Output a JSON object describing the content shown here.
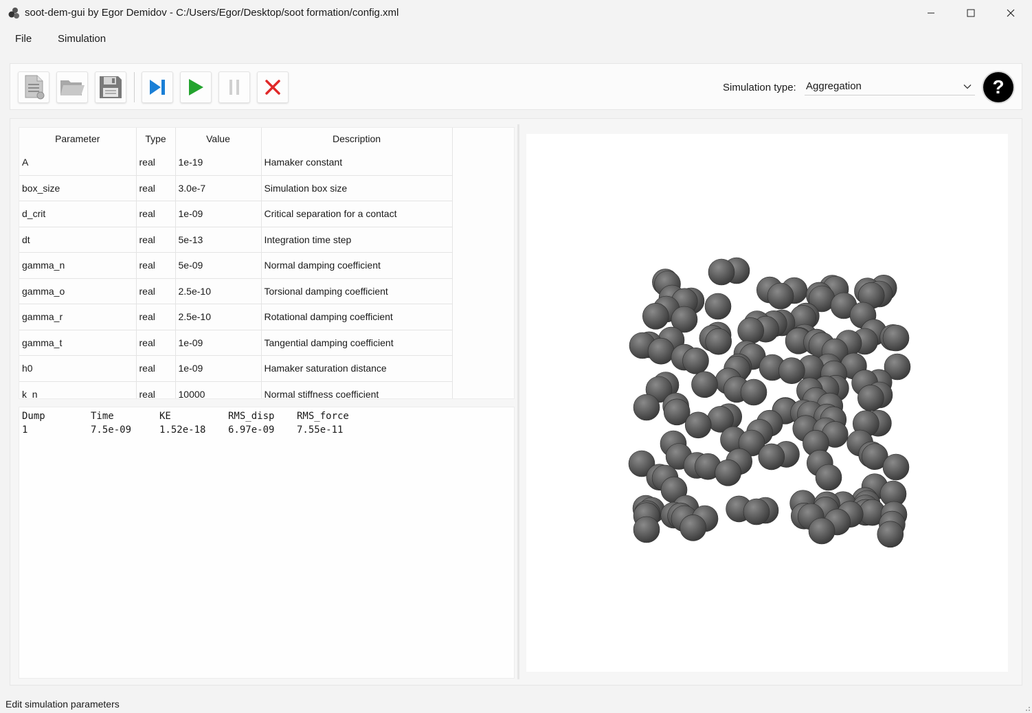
{
  "window": {
    "title": "soot-dem-gui by Egor Demidov - C:/Users/Egor/Desktop/soot formation/config.xml",
    "controls": [
      "minimize-icon",
      "maximize-icon",
      "close-icon"
    ]
  },
  "menu": {
    "file": "File",
    "simulation": "Simulation"
  },
  "toolbar": {
    "buttons": [
      "new-file-icon",
      "open-folder-icon",
      "save-icon",
      "step-icon",
      "play-icon",
      "pause-icon",
      "stop-icon"
    ],
    "sim_type_label": "Simulation type:",
    "sim_type_value": "Aggregation",
    "help_label": "?"
  },
  "params": {
    "headers": [
      "Parameter",
      "Type",
      "Value",
      "Description"
    ],
    "rows": [
      [
        "A",
        "real",
        "1e-19",
        "Hamaker constant"
      ],
      [
        "box_size",
        "real",
        "3.0e-7",
        "Simulation box size"
      ],
      [
        "d_crit",
        "real",
        "1e-09",
        "Critical separation for a contact"
      ],
      [
        "dt",
        "real",
        "5e-13",
        "Integration time step"
      ],
      [
        "gamma_n",
        "real",
        "5e-09",
        "Normal damping coefficient"
      ],
      [
        "gamma_o",
        "real",
        "2.5e-10",
        "Torsional damping coefficient"
      ],
      [
        "gamma_r",
        "real",
        "2.5e-10",
        "Rotational damping coefficient"
      ],
      [
        "gamma_t",
        "real",
        "1e-09",
        "Tangential damping coefficient"
      ],
      [
        "h0",
        "real",
        "1e-09",
        "Hamaker saturation distance"
      ],
      [
        "k_n",
        "real",
        "10000",
        "Normal stiffness coefficient"
      ]
    ]
  },
  "log": {
    "headers": [
      "Dump",
      "Time",
      "KE",
      "RMS_disp",
      "RMS_force"
    ],
    "rows": [
      [
        "1",
        "7.5e-09",
        "1.52e-18",
        "6.97e-09",
        "7.55e-11"
      ]
    ]
  },
  "status": "Edit simulation parameters",
  "colors": {
    "particle": "#5a5a5a",
    "step": "#1a7fd6",
    "play": "#23a32e",
    "stop": "#e02828"
  }
}
